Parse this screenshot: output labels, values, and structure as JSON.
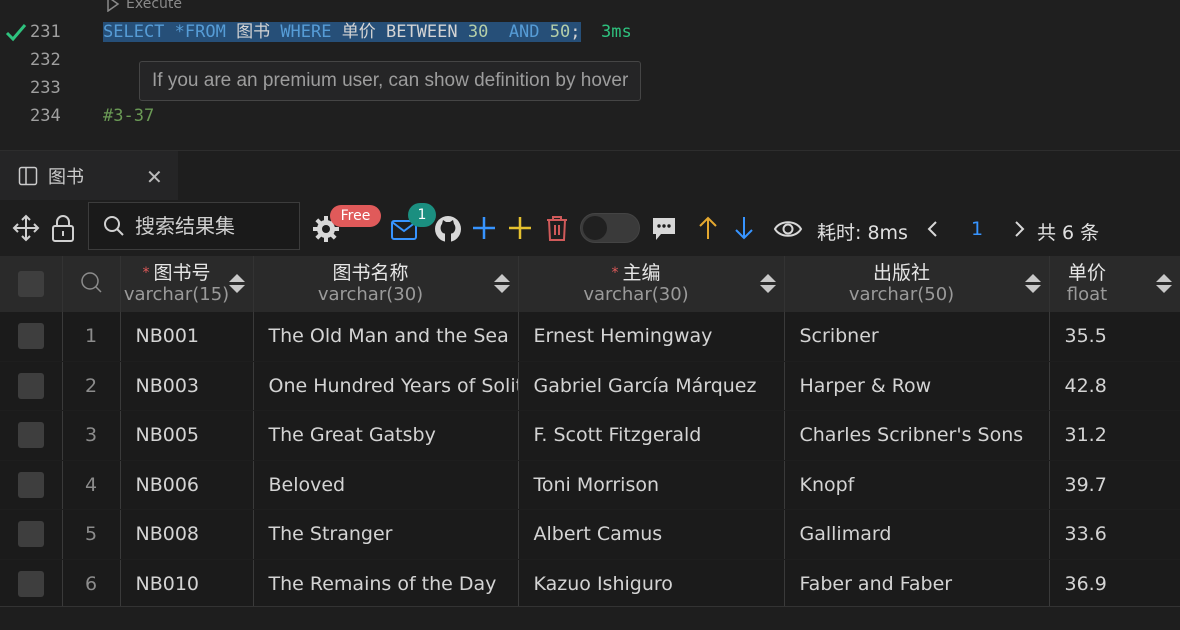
{
  "editor": {
    "execute_label": "Execute",
    "lines": [
      {
        "number": "231",
        "status": "success"
      },
      {
        "number": "232"
      },
      {
        "number": "233"
      },
      {
        "number": "234"
      }
    ],
    "sql": {
      "select": "SELECT",
      "star_from": " *FROM ",
      "table": "图书",
      "where": " WHERE ",
      "column": "单价",
      "between": " BETWEEN ",
      "low": "30",
      "and": "  AND ",
      "high": "50",
      "semi": ";",
      "time": "3ms"
    },
    "comment_line": "#3-37",
    "hover_hint": "If you are an premium user, can show definition by hover"
  },
  "tab": {
    "label": "图书",
    "close": "✕"
  },
  "toolbar": {
    "search_placeholder": "搜索结果集",
    "free_badge": "Free",
    "mail_count": "1",
    "elapsed_label": "耗时: 8ms",
    "page": "1",
    "total_label": "共 6 条",
    "toggle_on": false
  },
  "grid": {
    "columns": [
      {
        "name": "图书号",
        "type": "varchar(15)",
        "required": true
      },
      {
        "name": "图书名称",
        "type": "varchar(30)",
        "required": false
      },
      {
        "name": "主编",
        "type": "varchar(30)",
        "required": true
      },
      {
        "name": "出版社",
        "type": "varchar(50)",
        "required": false
      },
      {
        "name": "单价",
        "type": "float",
        "required": false
      }
    ],
    "rows": [
      {
        "n": "1",
        "id": "NB001",
        "title": "The Old Man and the Sea",
        "editor": "Ernest Hemingway",
        "publisher": "Scribner",
        "price": "35.5"
      },
      {
        "n": "2",
        "id": "NB003",
        "title": "One Hundred Years of Solitude",
        "editor": "Gabriel García Márquez",
        "publisher": "Harper & Row",
        "price": "42.8"
      },
      {
        "n": "3",
        "id": "NB005",
        "title": "The Great Gatsby",
        "editor": "F. Scott Fitzgerald",
        "publisher": "Charles Scribner's Sons",
        "price": "31.2"
      },
      {
        "n": "4",
        "id": "NB006",
        "title": "Beloved",
        "editor": "Toni Morrison",
        "publisher": "Knopf",
        "price": "39.7"
      },
      {
        "n": "5",
        "id": "NB008",
        "title": "The Stranger",
        "editor": "Albert Camus",
        "publisher": "Gallimard",
        "price": "33.6"
      },
      {
        "n": "6",
        "id": "NB010",
        "title": "The Remains of the Day",
        "editor": "Kazuo Ishiguro",
        "publisher": "Faber and Faber",
        "price": "36.9"
      }
    ]
  },
  "colors": {
    "keyword": "#569cd6",
    "number": "#b5cea8",
    "success": "#2ec27e",
    "accent_blue": "#3794ff",
    "warn_red": "#e05a5a"
  }
}
